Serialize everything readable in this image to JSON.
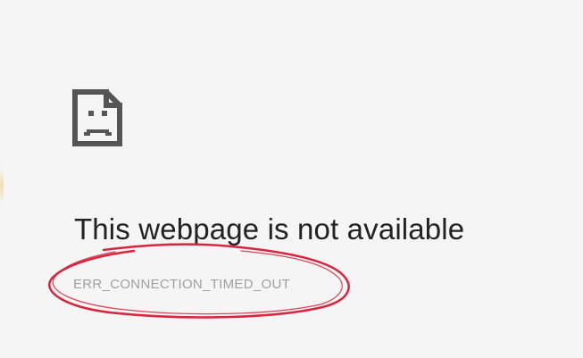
{
  "error_page": {
    "icon": "sad-page-icon",
    "title": "This webpage is not available",
    "error_code": "ERR_CONNECTION_TIMED_OUT"
  },
  "colors": {
    "background": "#f5f5f5",
    "icon": "#555555",
    "title": "#222222",
    "error_code": "#a0a0a0",
    "annotation": "#d7263d"
  }
}
